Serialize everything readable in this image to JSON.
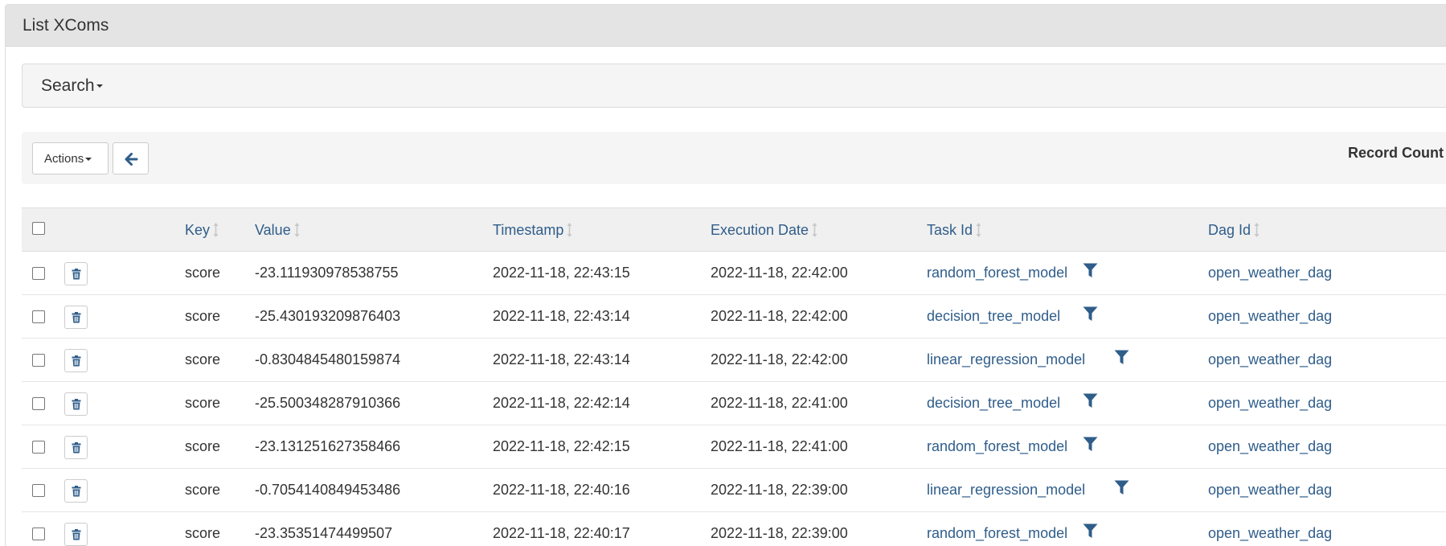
{
  "page": {
    "title": "List XComs"
  },
  "search": {
    "label": "Search"
  },
  "toolbar": {
    "actions_label": "Actions",
    "record_count_label": "Record Count"
  },
  "table": {
    "columns": [
      {
        "label": "Key"
      },
      {
        "label": "Value"
      },
      {
        "label": "Timestamp"
      },
      {
        "label": "Execution Date"
      },
      {
        "label": "Task Id"
      },
      {
        "label": "Dag Id"
      }
    ],
    "rows": [
      {
        "key": "score",
        "value": "-23.111930978538755",
        "timestamp": "2022-11-18, 22:43:15",
        "execution_date": "2022-11-18, 22:42:00",
        "task_id": "random_forest_model",
        "dag_id": "open_weather_dag"
      },
      {
        "key": "score",
        "value": "-25.430193209876403",
        "timestamp": "2022-11-18, 22:43:14",
        "execution_date": "2022-11-18, 22:42:00",
        "task_id": "decision_tree_model",
        "dag_id": "open_weather_dag"
      },
      {
        "key": "score",
        "value": "-0.8304845480159874",
        "timestamp": "2022-11-18, 22:43:14",
        "execution_date": "2022-11-18, 22:42:00",
        "task_id": "linear_regression_model",
        "dag_id": "open_weather_dag"
      },
      {
        "key": "score",
        "value": "-25.500348287910366",
        "timestamp": "2022-11-18, 22:42:14",
        "execution_date": "2022-11-18, 22:41:00",
        "task_id": "decision_tree_model",
        "dag_id": "open_weather_dag"
      },
      {
        "key": "score",
        "value": "-23.131251627358466",
        "timestamp": "2022-11-18, 22:42:15",
        "execution_date": "2022-11-18, 22:41:00",
        "task_id": "random_forest_model",
        "dag_id": "open_weather_dag"
      },
      {
        "key": "score",
        "value": "-0.7054140849453486",
        "timestamp": "2022-11-18, 22:40:16",
        "execution_date": "2022-11-18, 22:39:00",
        "task_id": "linear_regression_model",
        "dag_id": "open_weather_dag"
      },
      {
        "key": "score",
        "value": "-23.35351474499507",
        "timestamp": "2022-11-18, 22:40:17",
        "execution_date": "2022-11-18, 22:39:00",
        "task_id": "random_forest_model",
        "dag_id": "open_weather_dag"
      }
    ]
  },
  "icons": {
    "back": "arrow-left-icon",
    "delete": "trash-icon",
    "filter": "filter-icon",
    "sort": "sort-icon"
  },
  "colors": {
    "link": "#2f5d8a",
    "heading_bg": "#e4e4e4",
    "well_bg": "#f5f5f5",
    "table_header_bg": "#f0f0f0"
  }
}
